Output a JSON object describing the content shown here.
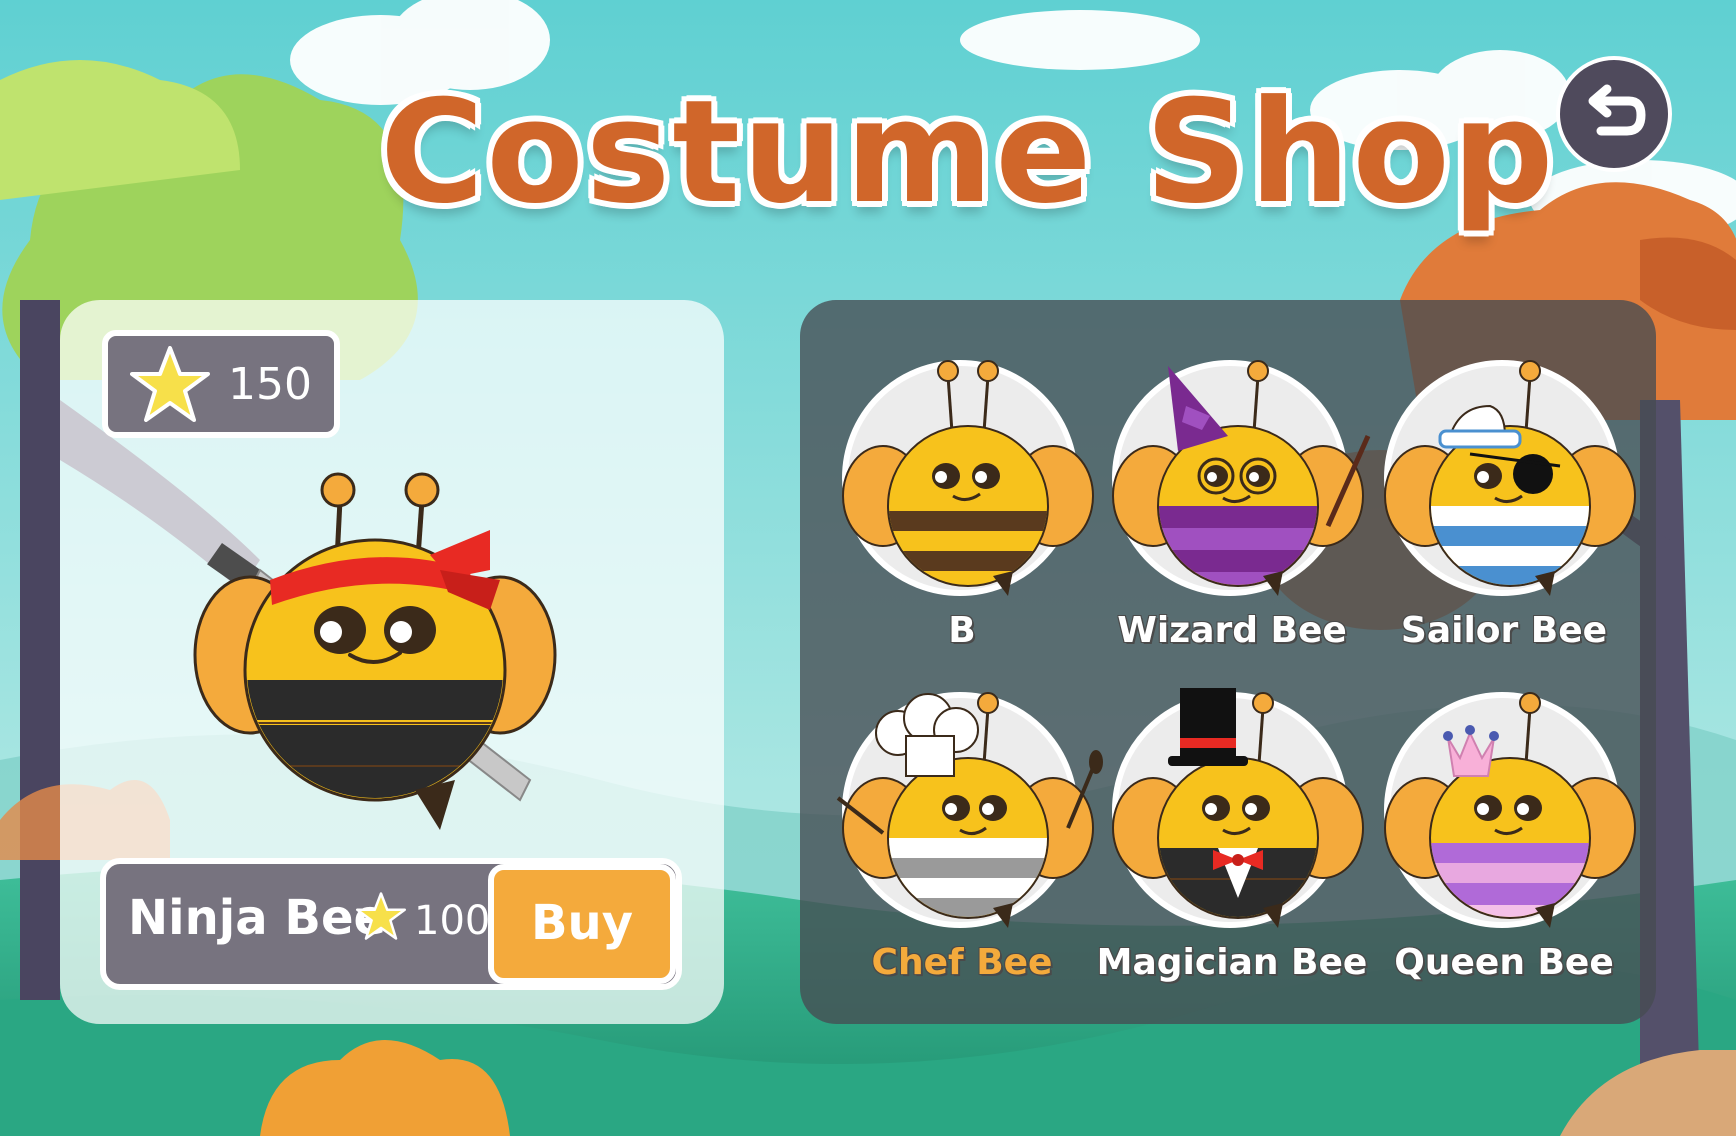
{
  "title": "Costume Shop",
  "back_button": {
    "icon": "undo-arrow-icon"
  },
  "player": {
    "stars": "150",
    "star_icon": "star-icon"
  },
  "preview": {
    "costume": "Ninja Bee",
    "price": "100",
    "buy_label": "Buy"
  },
  "costumes": [
    {
      "label": "B",
      "selected": false
    },
    {
      "label": "Wizard Bee",
      "selected": false
    },
    {
      "label": "Sailor Bee",
      "selected": false
    },
    {
      "label": "Chef Bee",
      "selected": true
    },
    {
      "label": "Magician Bee",
      "selected": false
    },
    {
      "label": "Queen Bee",
      "selected": false
    }
  ],
  "colors": {
    "title": "#d0662a",
    "buy_button": "#f4aa3c",
    "selected_label": "#f4aa3c",
    "panel_dark": "#77737f",
    "bee_yellow": "#f7c21c",
    "wing_orange": "#f4aa3c"
  }
}
